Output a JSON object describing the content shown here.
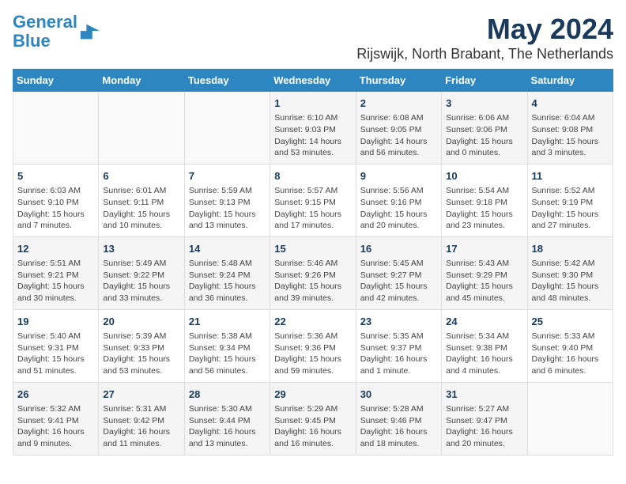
{
  "app": {
    "name": "GeneralBlue",
    "logo_line1": "General",
    "logo_line2": "Blue"
  },
  "header": {
    "month_year": "May 2024",
    "location": "Rijswijk, North Brabant, The Netherlands"
  },
  "weekdays": [
    "Sunday",
    "Monday",
    "Tuesday",
    "Wednesday",
    "Thursday",
    "Friday",
    "Saturday"
  ],
  "weeks": [
    [
      {
        "day": "",
        "info": ""
      },
      {
        "day": "",
        "info": ""
      },
      {
        "day": "",
        "info": ""
      },
      {
        "day": "1",
        "info": "Sunrise: 6:10 AM\nSunset: 9:03 PM\nDaylight: 14 hours and 53 minutes."
      },
      {
        "day": "2",
        "info": "Sunrise: 6:08 AM\nSunset: 9:05 PM\nDaylight: 14 hours and 56 minutes."
      },
      {
        "day": "3",
        "info": "Sunrise: 6:06 AM\nSunset: 9:06 PM\nDaylight: 15 hours and 0 minutes."
      },
      {
        "day": "4",
        "info": "Sunrise: 6:04 AM\nSunset: 9:08 PM\nDaylight: 15 hours and 3 minutes."
      }
    ],
    [
      {
        "day": "5",
        "info": "Sunrise: 6:03 AM\nSunset: 9:10 PM\nDaylight: 15 hours and 7 minutes."
      },
      {
        "day": "6",
        "info": "Sunrise: 6:01 AM\nSunset: 9:11 PM\nDaylight: 15 hours and 10 minutes."
      },
      {
        "day": "7",
        "info": "Sunrise: 5:59 AM\nSunset: 9:13 PM\nDaylight: 15 hours and 13 minutes."
      },
      {
        "day": "8",
        "info": "Sunrise: 5:57 AM\nSunset: 9:15 PM\nDaylight: 15 hours and 17 minutes."
      },
      {
        "day": "9",
        "info": "Sunrise: 5:56 AM\nSunset: 9:16 PM\nDaylight: 15 hours and 20 minutes."
      },
      {
        "day": "10",
        "info": "Sunrise: 5:54 AM\nSunset: 9:18 PM\nDaylight: 15 hours and 23 minutes."
      },
      {
        "day": "11",
        "info": "Sunrise: 5:52 AM\nSunset: 9:19 PM\nDaylight: 15 hours and 27 minutes."
      }
    ],
    [
      {
        "day": "12",
        "info": "Sunrise: 5:51 AM\nSunset: 9:21 PM\nDaylight: 15 hours and 30 minutes."
      },
      {
        "day": "13",
        "info": "Sunrise: 5:49 AM\nSunset: 9:22 PM\nDaylight: 15 hours and 33 minutes."
      },
      {
        "day": "14",
        "info": "Sunrise: 5:48 AM\nSunset: 9:24 PM\nDaylight: 15 hours and 36 minutes."
      },
      {
        "day": "15",
        "info": "Sunrise: 5:46 AM\nSunset: 9:26 PM\nDaylight: 15 hours and 39 minutes."
      },
      {
        "day": "16",
        "info": "Sunrise: 5:45 AM\nSunset: 9:27 PM\nDaylight: 15 hours and 42 minutes."
      },
      {
        "day": "17",
        "info": "Sunrise: 5:43 AM\nSunset: 9:29 PM\nDaylight: 15 hours and 45 minutes."
      },
      {
        "day": "18",
        "info": "Sunrise: 5:42 AM\nSunset: 9:30 PM\nDaylight: 15 hours and 48 minutes."
      }
    ],
    [
      {
        "day": "19",
        "info": "Sunrise: 5:40 AM\nSunset: 9:31 PM\nDaylight: 15 hours and 51 minutes."
      },
      {
        "day": "20",
        "info": "Sunrise: 5:39 AM\nSunset: 9:33 PM\nDaylight: 15 hours and 53 minutes."
      },
      {
        "day": "21",
        "info": "Sunrise: 5:38 AM\nSunset: 9:34 PM\nDaylight: 15 hours and 56 minutes."
      },
      {
        "day": "22",
        "info": "Sunrise: 5:36 AM\nSunset: 9:36 PM\nDaylight: 15 hours and 59 minutes."
      },
      {
        "day": "23",
        "info": "Sunrise: 5:35 AM\nSunset: 9:37 PM\nDaylight: 16 hours and 1 minute."
      },
      {
        "day": "24",
        "info": "Sunrise: 5:34 AM\nSunset: 9:38 PM\nDaylight: 16 hours and 4 minutes."
      },
      {
        "day": "25",
        "info": "Sunrise: 5:33 AM\nSunset: 9:40 PM\nDaylight: 16 hours and 6 minutes."
      }
    ],
    [
      {
        "day": "26",
        "info": "Sunrise: 5:32 AM\nSunset: 9:41 PM\nDaylight: 16 hours and 9 minutes."
      },
      {
        "day": "27",
        "info": "Sunrise: 5:31 AM\nSunset: 9:42 PM\nDaylight: 16 hours and 11 minutes."
      },
      {
        "day": "28",
        "info": "Sunrise: 5:30 AM\nSunset: 9:44 PM\nDaylight: 16 hours and 13 minutes."
      },
      {
        "day": "29",
        "info": "Sunrise: 5:29 AM\nSunset: 9:45 PM\nDaylight: 16 hours and 16 minutes."
      },
      {
        "day": "30",
        "info": "Sunrise: 5:28 AM\nSunset: 9:46 PM\nDaylight: 16 hours and 18 minutes."
      },
      {
        "day": "31",
        "info": "Sunrise: 5:27 AM\nSunset: 9:47 PM\nDaylight: 16 hours and 20 minutes."
      },
      {
        "day": "",
        "info": ""
      }
    ]
  ]
}
